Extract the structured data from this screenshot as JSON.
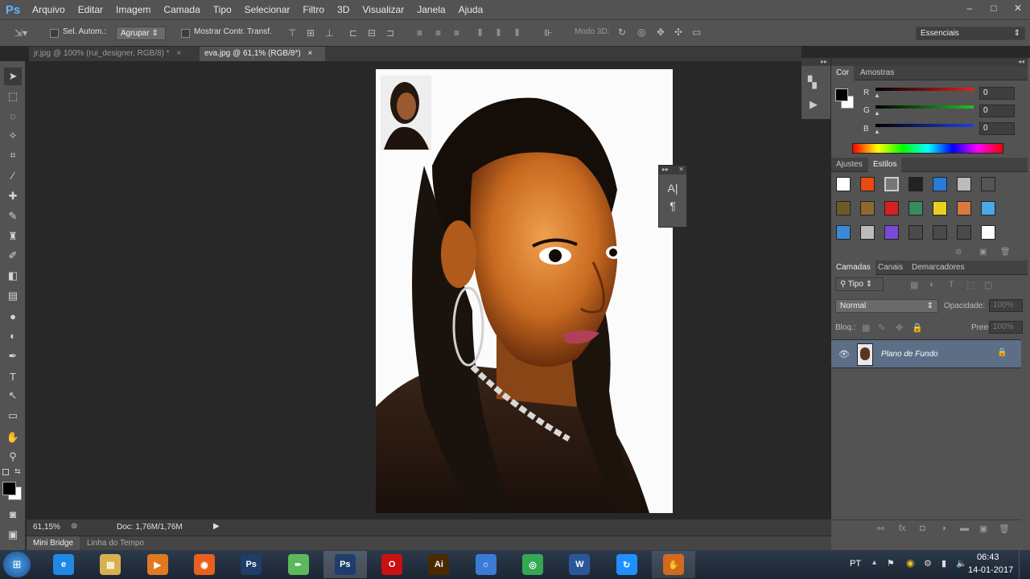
{
  "app": {
    "logo": "Ps"
  },
  "menu": [
    "Arquivo",
    "Editar",
    "Imagem",
    "Camada",
    "Tipo",
    "Selecionar",
    "Filtro",
    "3D",
    "Visualizar",
    "Janela",
    "Ajuda"
  ],
  "window_controls": {
    "minimize": "–",
    "restore": "□",
    "close": "✕"
  },
  "options": {
    "auto_select_label": "Sel. Autom.:",
    "group_value": "Agrupar",
    "transform_label": "Mostrar Contr. Transf.",
    "mode3d_label": "Modo 3D:",
    "workspace": "Essenciais"
  },
  "tabs": [
    {
      "label": "jr.jpg @ 100% (rui_designer, RGB/8) *",
      "close": "×",
      "active": false
    },
    {
      "label": "eva.jpg @ 61,1% (RGB/8*)",
      "close": "×",
      "active": true
    }
  ],
  "status": {
    "zoom": "61,15%",
    "doc": "Doc: 1,76M/1,76M"
  },
  "bottom_tabs": [
    "Mini Bridge",
    "Linha do Tempo"
  ],
  "color_panel": {
    "tabs": [
      "Cor",
      "Amostras"
    ],
    "channels": [
      {
        "name": "R",
        "value": "0",
        "color": "#e02020"
      },
      {
        "name": "G",
        "value": "0",
        "color": "#20c020"
      },
      {
        "name": "B",
        "value": "0",
        "color": "#2040e0"
      }
    ]
  },
  "styles_panel": {
    "tabs": [
      "Ajustes",
      "Estilos"
    ]
  },
  "layers_panel": {
    "tabs": [
      "Camadas",
      "Canais",
      "Demarcadores"
    ],
    "filter": "Tipo",
    "blend_mode": "Normal",
    "opacity_label": "Opacidade:",
    "opacity_value": "100%",
    "lock_label": "Bloq.:",
    "fill_label": "Preen.:",
    "fill_value": "100%",
    "layer_name": "Plano de Fundo"
  },
  "mini_panel": {
    "char_icon": "A|",
    "para_icon": "¶"
  },
  "taskbar": {
    "lang": "PT",
    "time": "06:43",
    "date": "14-01-2017",
    "apps": [
      {
        "label": "e",
        "color": "#1e88e5"
      },
      {
        "label": "▤",
        "color": "#d8b050"
      },
      {
        "label": "▶",
        "color": "#e07a20"
      },
      {
        "label": "◉",
        "color": "#e8601c"
      },
      {
        "label": "Ps",
        "color": "#1f3d6b"
      },
      {
        "label": "✒",
        "color": "#5cb85c"
      },
      {
        "label": "Ps",
        "color": "#1f3d6b"
      },
      {
        "label": "O",
        "color": "#cc1010"
      },
      {
        "label": "Ai",
        "color": "#4a2a00"
      },
      {
        "label": "☼",
        "color": "#3a7bd5"
      },
      {
        "label": "◎",
        "color": "#34a853"
      },
      {
        "label": "W",
        "color": "#2b579a"
      },
      {
        "label": "↻",
        "color": "#1e90ff"
      },
      {
        "label": "✋",
        "color": "#d2691e"
      }
    ]
  }
}
